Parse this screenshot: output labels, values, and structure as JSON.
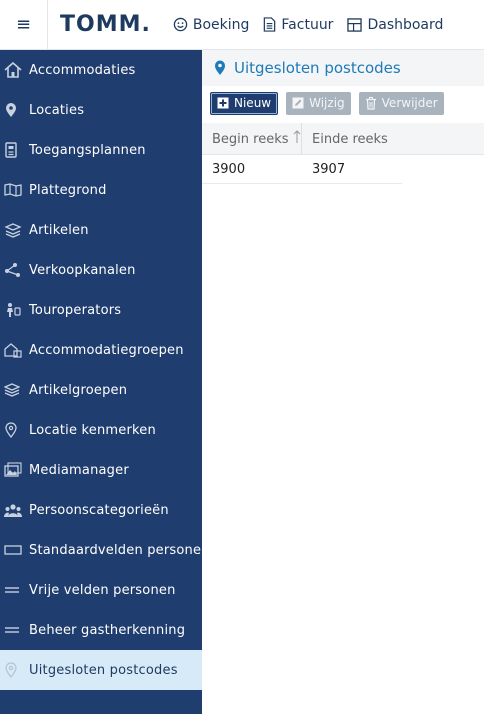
{
  "header": {
    "logo_text": "TOMM",
    "logo_dot": ".",
    "nav": [
      {
        "label": "Boeking",
        "icon": "smiley-icon"
      },
      {
        "label": "Factuur",
        "icon": "document-icon"
      },
      {
        "label": "Dashboard",
        "icon": "dashboard-icon"
      }
    ]
  },
  "sidebar": {
    "items": [
      {
        "label": "Accommodaties",
        "icon": "home-icon"
      },
      {
        "label": "Locaties",
        "icon": "map-pin-icon"
      },
      {
        "label": "Toegangsplannen",
        "icon": "access-plan-icon"
      },
      {
        "label": "Plattegrond",
        "icon": "map-icon"
      },
      {
        "label": "Artikelen",
        "icon": "articles-icon"
      },
      {
        "label": "Verkoopkanalen",
        "icon": "share-nodes-icon"
      },
      {
        "label": "Touroperators",
        "icon": "travel-icon"
      },
      {
        "label": "Accommodatiegroepen",
        "icon": "home-group-icon"
      },
      {
        "label": "Artikelgroepen",
        "icon": "layers-icon"
      },
      {
        "label": "Locatie kenmerken",
        "icon": "map-pin-outline-icon"
      },
      {
        "label": "Mediamanager",
        "icon": "images-icon"
      },
      {
        "label": "Persoonscategorieën",
        "icon": "users-icon"
      },
      {
        "label": "Standaardvelden personen",
        "icon": "rectangle-icon"
      },
      {
        "label": "Vrije velden personen",
        "icon": "equals-icon"
      },
      {
        "label": "Beheer gastherkenning",
        "icon": "equals-icon"
      },
      {
        "label": "Uitgesloten postcodes",
        "icon": "map-pin-outline-icon",
        "active": true
      }
    ]
  },
  "main": {
    "title": "Uitgesloten postcodes",
    "toolbar": {
      "new_label": "Nieuw",
      "edit_label": "Wijzig",
      "delete_label": "Verwijder"
    },
    "columns": [
      "Begin reeks",
      "Einde reeks"
    ],
    "rows": [
      [
        "3900",
        "3907"
      ]
    ]
  },
  "colors": {
    "sidebar_bg": "#1f3d6e",
    "sidebar_active_bg": "#d6eaf8",
    "accent": "#1e7ab8",
    "disabled_button": "#a9b3bd"
  }
}
